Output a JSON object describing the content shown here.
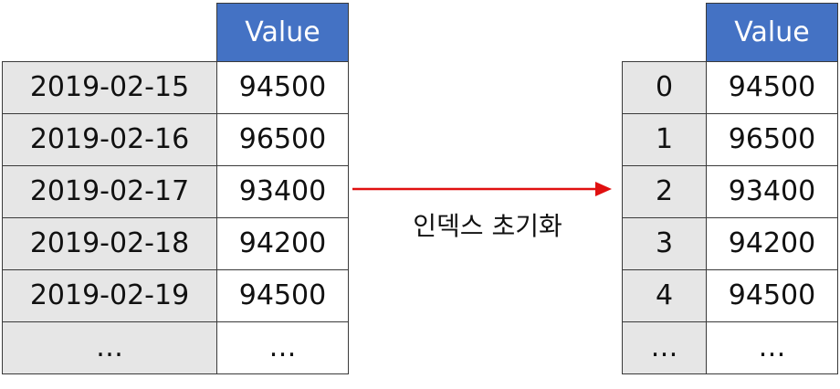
{
  "left_table": {
    "header": "Value",
    "rows": [
      {
        "index": "2019-02-15",
        "value": "94500"
      },
      {
        "index": "2019-02-16",
        "value": "96500"
      },
      {
        "index": "2019-02-17",
        "value": "93400"
      },
      {
        "index": "2019-02-18",
        "value": "94200"
      },
      {
        "index": "2019-02-19",
        "value": "94500"
      },
      {
        "index": "…",
        "value": "…"
      }
    ]
  },
  "right_table": {
    "header": "Value",
    "rows": [
      {
        "index": "0",
        "value": "94500"
      },
      {
        "index": "1",
        "value": "96500"
      },
      {
        "index": "2",
        "value": "93400"
      },
      {
        "index": "3",
        "value": "94200"
      },
      {
        "index": "4",
        "value": "94500"
      },
      {
        "index": "…",
        "value": "…"
      }
    ]
  },
  "arrow": {
    "label": "인덱스 초기화",
    "color": "#e01010"
  },
  "colors": {
    "header_bg": "#4472c4",
    "index_bg": "#e6e6e6"
  }
}
